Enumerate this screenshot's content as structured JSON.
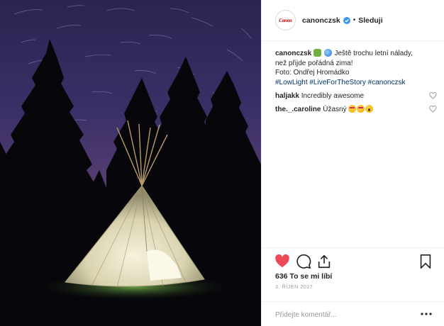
{
  "header": {
    "avatar_text": "Canon",
    "username": "canonczsk",
    "separator": "•",
    "follow_label": "Sleduji"
  },
  "caption": {
    "username": "canonczsk",
    "line1": "Ještě trochu letní nálady,",
    "line2": "než přijde pořádná zima!",
    "line3": "Foto: Ondřej Hromádko",
    "hashtags": [
      "#LowLight",
      "#LiveForTheStory",
      "#canonczsk"
    ]
  },
  "comments": [
    {
      "username": "haljakk",
      "text": "Incredibly awesome"
    },
    {
      "username": "the._.caroline",
      "text": "Úžasný"
    }
  ],
  "actions": {
    "like_icon": "heart-filled-icon",
    "comment_icon": "comment-bubble-icon",
    "share_icon": "share-icon",
    "save_icon": "bookmark-icon",
    "like_color": "#ed4956"
  },
  "likes_text": "636 To se mi líbí",
  "date_text": "3. ŘÍJEN 2017",
  "add_comment": {
    "placeholder": "Přidejte komentář...",
    "more_icon": "more-dots-icon"
  },
  "colors": {
    "hashtag": "#003569",
    "verified": "#3897f0",
    "brand": "#cc0000"
  }
}
